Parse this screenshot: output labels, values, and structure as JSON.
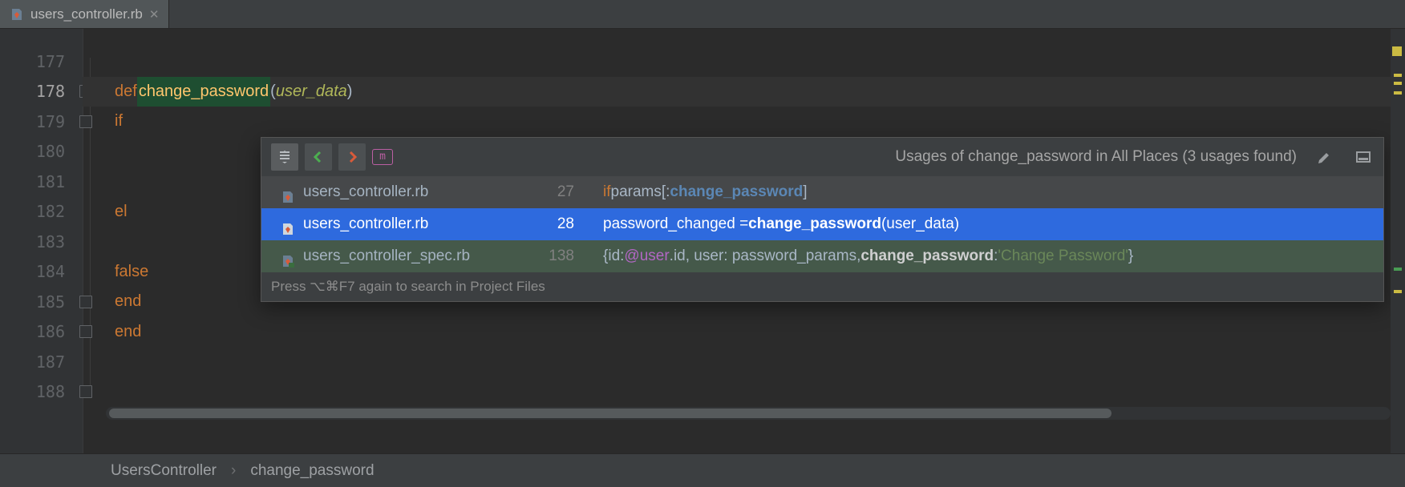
{
  "tab": {
    "label": "users_controller.rb"
  },
  "gutter": [
    "177",
    "178",
    "179",
    "180",
    "181",
    "182",
    "183",
    "184",
    "185",
    "186",
    "187",
    "188"
  ],
  "code": {
    "def": "def",
    "fn": "change_password",
    "param": "user_data",
    "if": "if",
    "el": "el",
    "false": "false",
    "end1": "end",
    "end2": "end"
  },
  "popup": {
    "title": "Usages of change_password in All Places (3 usages found)",
    "hint": "Press ⌥⌘F7 again to search in Project Files",
    "rows": [
      {
        "file": "users_controller.rb",
        "line": "27",
        "code_html": "<span class='kw2'>if</span> params[:<span class='sym'>change_password</span>]"
      },
      {
        "file": "users_controller.rb",
        "line": "28",
        "code_html": "password_changed = <span class='bold'>change_password</span>(user_data)"
      },
      {
        "file": "users_controller_spec.rb",
        "line": "138",
        "code_html": "{id: <span class='ivar'>@user</span><span class='meth'>.id</span>, user: password_params, <span class='bold'>change_password</span>: <span class='str'>'Change Password'</span>}"
      }
    ]
  },
  "crumbs": {
    "a": "UsersController",
    "b": "change_password"
  }
}
